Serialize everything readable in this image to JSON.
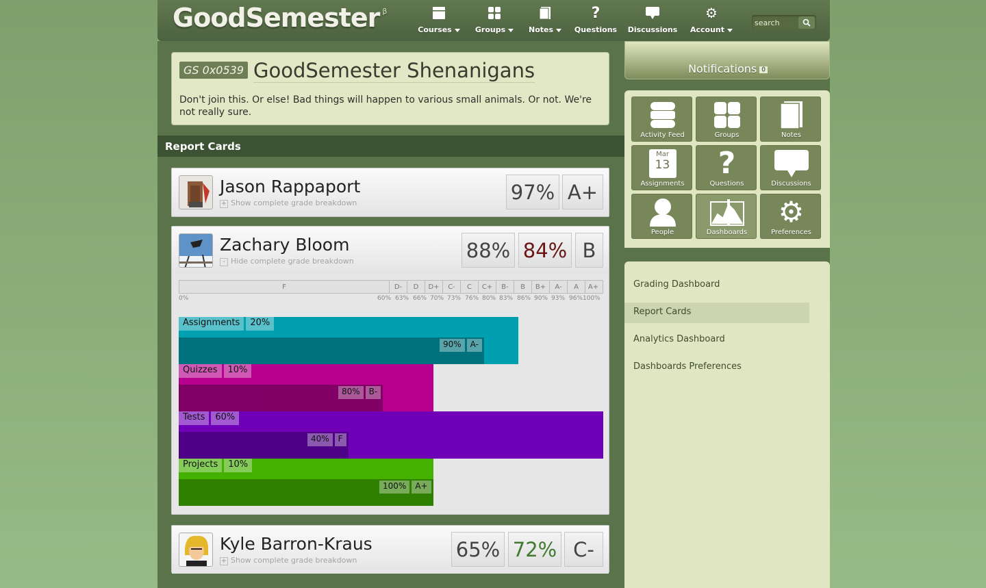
{
  "app": {
    "logo": "GoodSemester",
    "logo_sup": "β"
  },
  "nav": [
    {
      "label": "Courses",
      "icon": "courses-icon",
      "dropdown": true
    },
    {
      "label": "Groups",
      "icon": "groups-icon",
      "dropdown": true
    },
    {
      "label": "Notes",
      "icon": "notes-icon",
      "dropdown": true
    },
    {
      "label": "Questions",
      "icon": "question-icon",
      "dropdown": false
    },
    {
      "label": "Discussions",
      "icon": "discussion-icon",
      "dropdown": false
    },
    {
      "label": "Account",
      "icon": "gear-icon",
      "dropdown": true
    }
  ],
  "search": {
    "placeholder": "search"
  },
  "group": {
    "id": "GS 0x0539",
    "title": "GoodSemester Shenanigans",
    "description": "Don't join this. Or else! Bad things will happen to various small animals. Or not. We're not really sure."
  },
  "section": {
    "title": "Report Cards"
  },
  "students": [
    {
      "name": "Jason Rappaport",
      "toggle": "Show complete grade breakdown",
      "toggle_icon": "+",
      "grades": [
        "97%",
        "A+"
      ]
    },
    {
      "name": "Zachary Bloom",
      "toggle": "Hide complete grade breakdown",
      "toggle_icon": "-",
      "grades": [
        "88%",
        "84%",
        "B"
      ]
    },
    {
      "name": "Kyle Barron-Kraus",
      "toggle": "Show complete grade breakdown",
      "toggle_icon": "+",
      "grades": [
        "65%",
        "72%",
        "C-"
      ]
    }
  ],
  "scale": {
    "letters": [
      "F",
      "D-",
      "D",
      "D+",
      "C-",
      "C",
      "C+",
      "B-",
      "B",
      "B+",
      "A-",
      "A",
      "A+"
    ],
    "percents": [
      "0%",
      "60%",
      "63%",
      "66%",
      "70%",
      "73%",
      "76%",
      "80%",
      "83%",
      "86%",
      "90%",
      "93%",
      "96%",
      "100%"
    ]
  },
  "breakdown": [
    {
      "name": "Assignments",
      "weight": "20%",
      "score": "90%",
      "grade": "A-",
      "weight_value": 0.8,
      "score_value": 0.9,
      "color": "#00a0b0",
      "dark": "#006d77"
    },
    {
      "name": "Quizzes",
      "weight": "10%",
      "score": "80%",
      "grade": "B-",
      "weight_value": 0.6,
      "score_value": 0.8,
      "color": "#b8008f",
      "dark": "#7a0060"
    },
    {
      "name": "Tests",
      "weight": "60%",
      "score": "40%",
      "grade": "F",
      "weight_value": 1.0,
      "score_value": 0.4,
      "color": "#7000b8",
      "dark": "#4a0080"
    },
    {
      "name": "Projects",
      "weight": "10%",
      "score": "100%",
      "grade": "A+",
      "weight_value": 0.6,
      "score_value": 1.0,
      "color": "#44b000",
      "dark": "#2e7a00"
    }
  ],
  "sidebar": {
    "notifications_label": "Notifications",
    "notifications_count": "0",
    "tiles": [
      {
        "label": "Activity Feed",
        "icon": "activity-feed-icon"
      },
      {
        "label": "Groups",
        "icon": "groups-icon"
      },
      {
        "label": "Notes",
        "icon": "notes-icon"
      },
      {
        "label": "Assignments",
        "icon": "calendar-icon",
        "month": "Mar",
        "day": "13"
      },
      {
        "label": "Questions",
        "icon": "question-icon"
      },
      {
        "label": "Discussions",
        "icon": "discussion-icon"
      },
      {
        "label": "People",
        "icon": "person-icon"
      },
      {
        "label": "Dashboards",
        "icon": "dashboard-icon"
      },
      {
        "label": "Preferences",
        "icon": "gear-icon"
      }
    ],
    "menu": [
      "Grading Dashboard",
      "Report Cards",
      "Analytics Dashboard",
      "Dashboards Preferences"
    ]
  },
  "colors": {
    "accent": "#5a734a",
    "dark": "#3c5232",
    "panel": "#e0e6c1"
  }
}
